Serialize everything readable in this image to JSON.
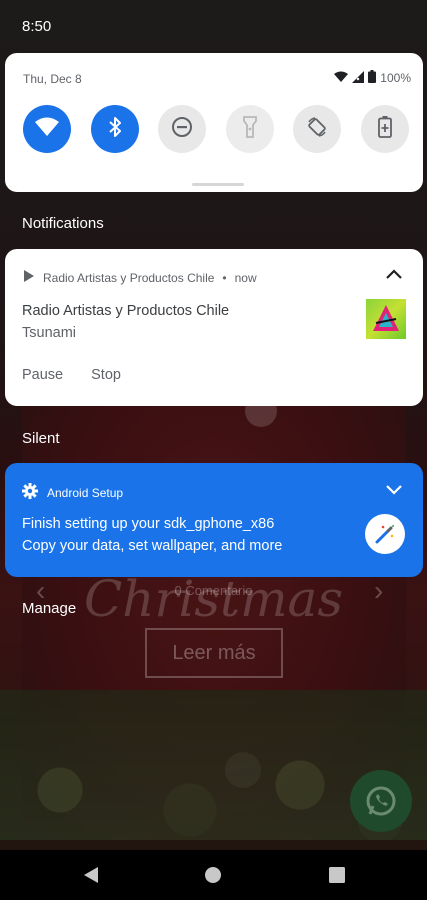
{
  "status_bar": {
    "time": "8:50"
  },
  "quick_settings": {
    "date": "Thu, Dec 8",
    "battery": "100%",
    "tiles": [
      {
        "name": "wifi",
        "state": "on"
      },
      {
        "name": "bluetooth",
        "state": "on"
      },
      {
        "name": "do-not-disturb",
        "state": "off"
      },
      {
        "name": "flashlight",
        "state": "disabled"
      },
      {
        "name": "auto-rotate",
        "state": "off"
      },
      {
        "name": "battery-saver",
        "state": "off"
      }
    ]
  },
  "sections": {
    "notifications": "Notifications",
    "silent": "Silent",
    "manage": "Manage"
  },
  "media_notification": {
    "app_name": "Radio Artistas y Productos Chile",
    "separator": "•",
    "time": "now",
    "title": "Radio Artistas y Productos Chile",
    "artist": "Tsunami",
    "actions": [
      "Pause",
      "Stop"
    ]
  },
  "setup_notification": {
    "app_name": "Android Setup",
    "line1": "Finish setting up your sdk_gphone_x86",
    "line2": "Copy your data, set wallpaper, and more"
  },
  "background_app": {
    "comment_count": "0 Comentario",
    "headline": "Christmas",
    "button": "Leer más"
  },
  "colors": {
    "accent": "#1a73e8",
    "panel": "#ffffff",
    "scrim": "#151515"
  }
}
